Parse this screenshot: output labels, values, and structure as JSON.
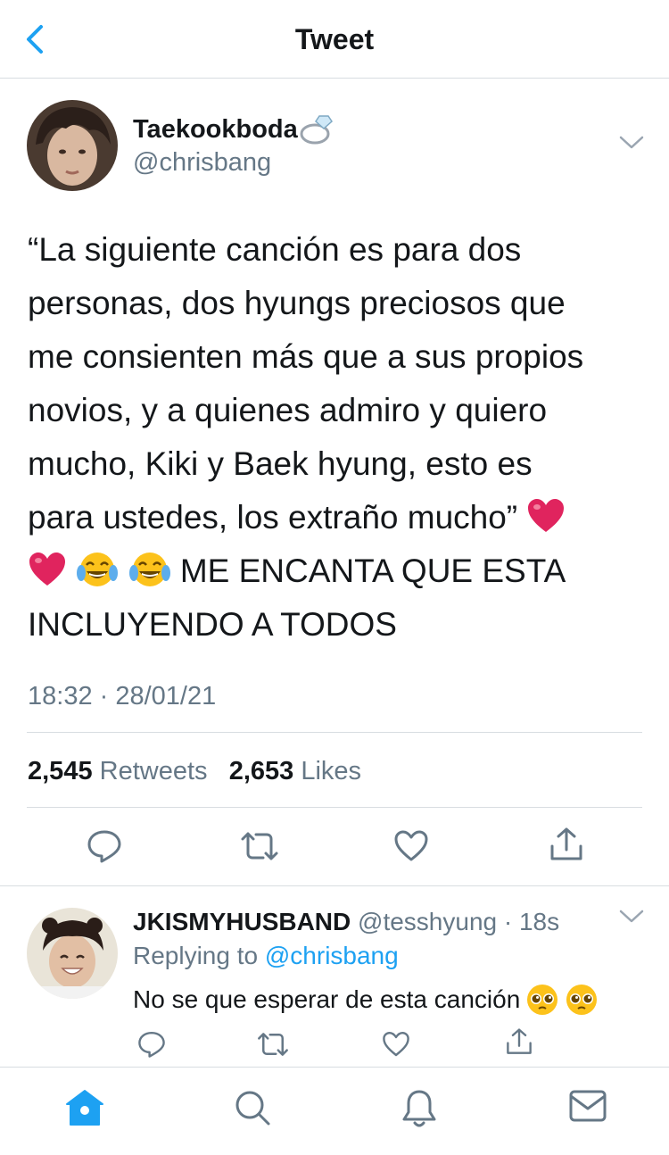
{
  "nav": {
    "title": "Tweet",
    "back_icon": "chevron-left-icon"
  },
  "tweet": {
    "author": {
      "name": "Taekookboda",
      "handle": "@chrisbang",
      "name_emoji": "ring-icon"
    },
    "text_parts": {
      "l1": "“La siguiente canción es para dos",
      "l2": "personas, dos hyungs preciosos que",
      "l3": "me consienten más que a sus propios",
      "l4": "novios, y a quienes admiro y quiero",
      "l5": "mucho, Kiki y Baek hyung, esto es",
      "l6": "para ustedes, los extraño mucho”",
      "l7": "ME ENCANTA QUE ESTA",
      "l8": "INCLUYENDO A TODOS"
    },
    "timestamp": "18:32 · 28/01/21",
    "retweets_count": "2,545",
    "retweets_label": "Retweets",
    "likes_count": "2,653",
    "likes_label": "Likes"
  },
  "reply": {
    "name": "JKISMYHUSBAND",
    "handle_time": "@tesshyung · 18s",
    "replying_prefix": "Replying to",
    "replying_to": "@chrisbang",
    "text": "No se que esperar de esta canción"
  },
  "tabbar": [
    "home-icon",
    "search-icon",
    "notifications-icon",
    "messages-icon"
  ],
  "colors": {
    "accent": "#1da1f2",
    "secondary_text": "#657786",
    "divider": "#d8dde1",
    "heart": "#e0245e"
  }
}
